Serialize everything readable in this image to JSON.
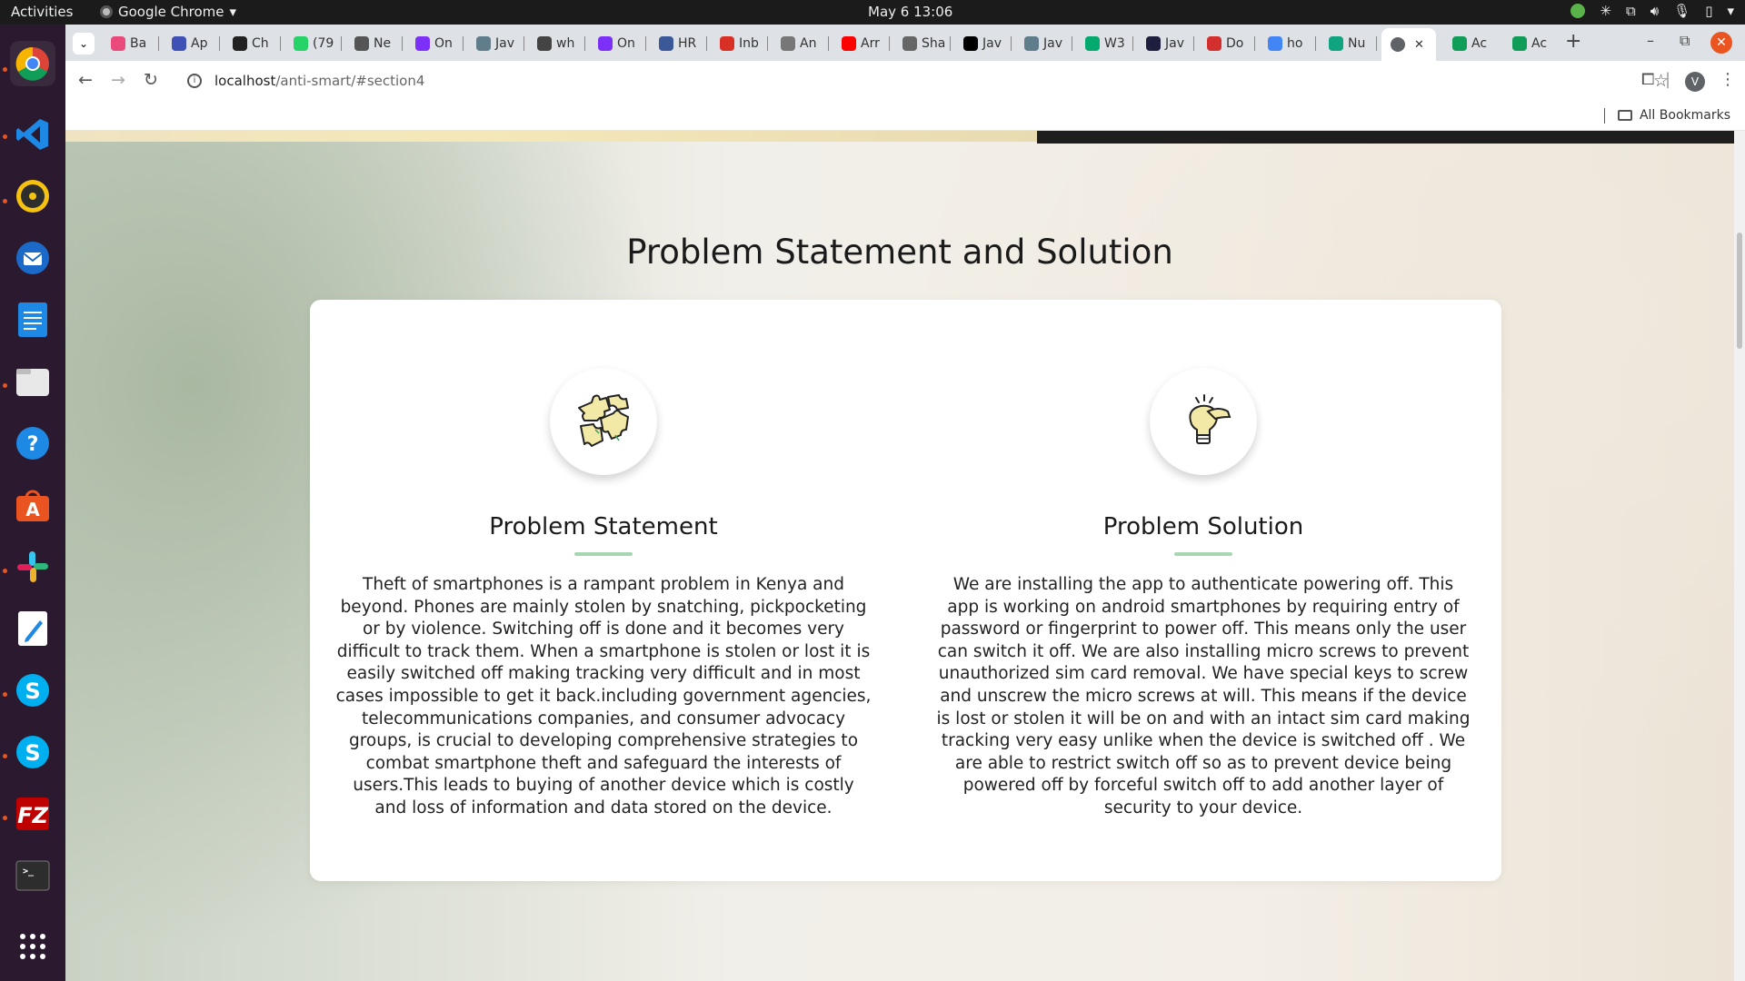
{
  "system": {
    "activities": "Activities",
    "app_name": "Google Chrome",
    "clock": "May 6  13:06"
  },
  "browser": {
    "tabs": [
      {
        "label": "Ba",
        "color": "#e94a7b"
      },
      {
        "label": "Ap",
        "color": "#3f51b5"
      },
      {
        "label": "Ch",
        "color": "#222222"
      },
      {
        "label": "(79",
        "color": "#25d366"
      },
      {
        "label": "Ne",
        "color": "#555555"
      },
      {
        "label": "On",
        "color": "#7b2ff7"
      },
      {
        "label": "Jav",
        "color": "#607d8b"
      },
      {
        "label": "wh",
        "color": "#444444"
      },
      {
        "label": "On",
        "color": "#7b2ff7"
      },
      {
        "label": "HR",
        "color": "#3b5998"
      },
      {
        "label": "Inb",
        "color": "#d93025"
      },
      {
        "label": "An",
        "color": "#777777"
      },
      {
        "label": "Arr",
        "color": "#ff0000"
      },
      {
        "label": "Sha",
        "color": "#666666"
      },
      {
        "label": "Jav",
        "color": "#000000"
      },
      {
        "label": "Jav",
        "color": "#607d8b"
      },
      {
        "label": "W3",
        "color": "#04aa6d"
      },
      {
        "label": "Jav",
        "color": "#1e1e3f"
      },
      {
        "label": "Do",
        "color": "#d32f2f"
      },
      {
        "label": "ho",
        "color": "#4285f4"
      },
      {
        "label": "Nu",
        "color": "#10a37f"
      }
    ],
    "active_tab": {
      "label": "",
      "color": "#5f6368"
    },
    "extra_tabs": [
      {
        "label": "Ac",
        "color": "#0f9d58"
      },
      {
        "label": "Ac",
        "color": "#0f9d58"
      }
    ],
    "url_host": "localhost",
    "url_path": "/anti-smart/#section4",
    "profile_initial": "V",
    "bookmarks_label": "All Bookmarks"
  },
  "page": {
    "section_title": "Problem Statement and Solution",
    "problem": {
      "heading": "Problem Statement",
      "icon": "puzzle-icon",
      "body": "Theft of smartphones is a rampant problem in Kenya and beyond. Phones are mainly stolen by snatching, pickpocketing or by violence. Switching off is done and it becomes very difficult to track them. When a smartphone is stolen or lost it is easily switched off making tracking very difficult and in most cases impossible to get it back.including government agencies, telecommunications companies, and consumer advocacy groups, is crucial to developing comprehensive strategies to combat smartphone theft and safeguard the interests of users.This leads to buying of another device which is costly and loss of information and data stored on the device."
    },
    "solution": {
      "heading": "Problem Solution",
      "icon": "lightbulb-icon",
      "body": "We are installing the app to authenticate powering off. This app is working on android smartphones by requiring entry of password or fingerprint to power off. This means only the user can switch it off. We are also installing micro screws to prevent unauthorized sim card removal. We have special keys to screw and unscrew the micro screws at will. This means if the device is lost or stolen it will be on and with an intact sim card making tracking very easy unlike when the device is switched off . We are able to restrict switch off so as to prevent device being powered off by forceful switch off to add another layer of security to your device."
    },
    "accent_color": "#a6d6b2"
  },
  "dock": [
    {
      "name": "chrome-icon",
      "color": "#4285f4"
    },
    {
      "name": "vscode-icon",
      "color": "#0078d4"
    },
    {
      "name": "rhythmbox-icon",
      "color": "#f5c211"
    },
    {
      "name": "thunderbird-icon",
      "color": "#1b6ac9"
    },
    {
      "name": "writer-icon",
      "color": "#1e88e5"
    },
    {
      "name": "files-icon",
      "color": "#e8e8e8"
    },
    {
      "name": "help-icon",
      "color": "#1e88e5"
    },
    {
      "name": "app-center-icon",
      "color": "#e95420"
    },
    {
      "name": "slack-icon",
      "color": "#ffffff"
    },
    {
      "name": "text-editor-icon",
      "color": "#ffffff"
    },
    {
      "name": "skype-icon",
      "color": "#00aff0"
    },
    {
      "name": "skype-icon",
      "color": "#00aff0"
    },
    {
      "name": "filezilla-icon",
      "color": "#bf0000"
    },
    {
      "name": "terminal-icon",
      "color": "#2d2d2d"
    },
    {
      "name": "show-apps-icon",
      "color": "#2b1a2f"
    }
  ]
}
